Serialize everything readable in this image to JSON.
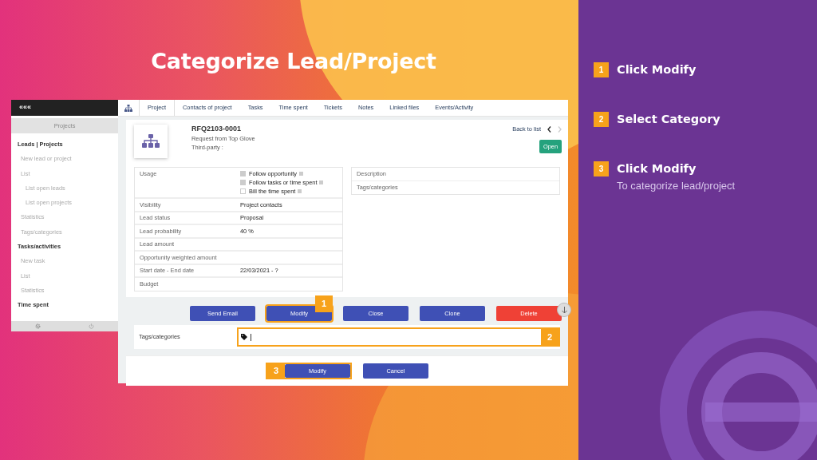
{
  "slide": {
    "title": "Categorize Lead/Project"
  },
  "sidebar": {
    "collapse": "«««",
    "section": "Projects",
    "items": [
      {
        "label": "Leads | Projects",
        "kind": "heading"
      },
      {
        "label": "New lead or project",
        "kind": "item"
      },
      {
        "label": "List",
        "kind": "item"
      },
      {
        "label": "List open leads",
        "kind": "subitem"
      },
      {
        "label": "List open projects",
        "kind": "subitem"
      },
      {
        "label": "Statistics",
        "kind": "item"
      },
      {
        "label": "Tags/categories",
        "kind": "item"
      },
      {
        "label": "Tasks/activities",
        "kind": "heading"
      },
      {
        "label": "New task",
        "kind": "item"
      },
      {
        "label": "List",
        "kind": "item"
      },
      {
        "label": "Statistics",
        "kind": "item"
      },
      {
        "label": "Time spent",
        "kind": "heading"
      }
    ]
  },
  "tabs": [
    {
      "label": "Project",
      "selected": true
    },
    {
      "label": "Contacts of project",
      "selected": false
    },
    {
      "label": "Tasks",
      "selected": false
    },
    {
      "label": "Time spent",
      "selected": false
    },
    {
      "label": "Tickets",
      "selected": false
    },
    {
      "label": "Notes",
      "selected": false
    },
    {
      "label": "Linked files",
      "selected": false
    },
    {
      "label": "Events/Activity",
      "selected": false
    }
  ],
  "record": {
    "ref": "RFQ2103-0001",
    "subtitle": "Request from Top Glove",
    "third_party": "Third-party :",
    "back": "Back to list",
    "prev_enabled": true,
    "next_enabled": false,
    "status": "Open"
  },
  "usage": {
    "label": "Usage",
    "options": [
      {
        "label": "Follow opportunity",
        "checked": true
      },
      {
        "label": "Follow tasks or time spent",
        "checked": true
      },
      {
        "label": "Bill the time spent",
        "checked": false
      }
    ]
  },
  "fields": [
    {
      "label": "Visibility",
      "value": "Project contacts"
    },
    {
      "label": "Lead status",
      "value": "Proposal"
    },
    {
      "label": "Lead probability",
      "value": "40 %"
    },
    {
      "label": "Lead amount"
    },
    {
      "label": "Opportunity weighted amount"
    },
    {
      "label": "Start date - End date",
      "value": "22/03/2021 - ?"
    },
    {
      "label": "Budget"
    }
  ],
  "right_fields": [
    "Description",
    "Tags/categories"
  ],
  "actions": [
    {
      "label": "Send Email",
      "kind": "primary",
      "highlighted": false
    },
    {
      "label": "Modify",
      "kind": "primary",
      "highlighted": true,
      "step": "1"
    },
    {
      "label": "Close",
      "kind": "primary",
      "highlighted": false
    },
    {
      "label": "Clone",
      "kind": "primary",
      "highlighted": false
    },
    {
      "label": "Delete",
      "kind": "danger",
      "highlighted": false
    }
  ],
  "edit": {
    "label": "Tags/categories",
    "highlighted": true,
    "step": "2"
  },
  "form_buttons": [
    {
      "label": "Modify",
      "highlighted": true,
      "step": "3"
    },
    {
      "label": "Cancel",
      "highlighted": false
    }
  ],
  "steps": [
    {
      "number": "1",
      "title": "Click Modify"
    },
    {
      "number": "2",
      "title": "Select Category"
    },
    {
      "number": "3",
      "title": "Click Modify",
      "detail": "To categorize lead/project"
    }
  ]
}
